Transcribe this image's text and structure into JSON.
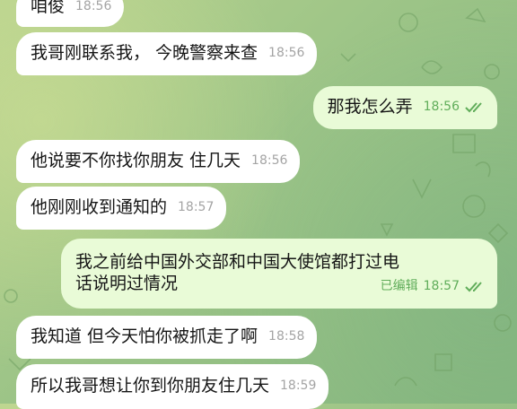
{
  "messages": [
    {
      "dir": "in",
      "text": "咱俊",
      "time": "18:56"
    },
    {
      "dir": "in",
      "text": "我哥刚联系我， 今晚警察来查",
      "time": "18:56"
    },
    {
      "dir": "out",
      "text": "那我怎么弄",
      "time": "18:56",
      "status": "read"
    },
    {
      "dir": "in",
      "text": "他说要不你找你朋友 住几天",
      "time": "18:56"
    },
    {
      "dir": "in",
      "text": "他刚刚收到通知的",
      "time": "18:57"
    },
    {
      "dir": "out",
      "text_line1": "我之前给中国外交部和中国大使馆都打过电",
      "text_line2": "话说明过情况",
      "edited": "已编辑",
      "time": "18:57",
      "status": "read"
    },
    {
      "dir": "in",
      "text": "我知道 但今天怕你被抓走了啊",
      "time": "18:58"
    },
    {
      "dir": "in",
      "text": "所以我哥想让你到你朋友住几天",
      "time": "18:59"
    }
  ],
  "icons": {
    "read_status": "double-check-icon"
  },
  "colors": {
    "incoming_bubble": "#ffffff",
    "outgoing_bubble": "#e9fbd7",
    "outgoing_meta": "#60ad5a",
    "incoming_meta": "#a4a4a4"
  }
}
